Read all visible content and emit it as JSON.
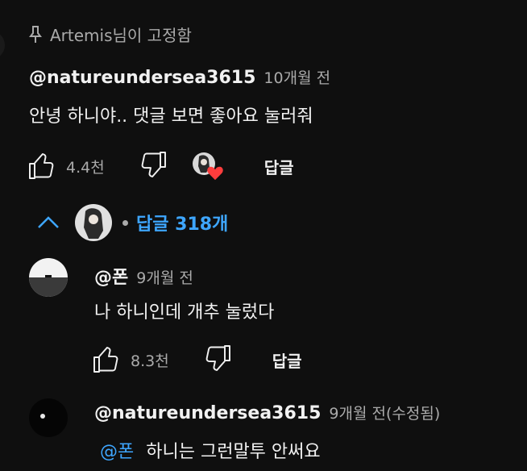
{
  "pinned": {
    "text": "Artemis님이 고정함",
    "icon": "pin-icon"
  },
  "main_comment": {
    "handle": "@natureundersea3615",
    "time": "10개월 전",
    "text": "안녕 하니야.. 댓글 보면 좋아요 눌러줘",
    "likes": "4.4천",
    "reply_label": "답글"
  },
  "replies_toggle": {
    "label": "답글 318개",
    "accent": "#3ea6ff"
  },
  "reply1": {
    "handle": "@폰",
    "time": "9개월 전",
    "text": "나 하니인데 개추 눌렀다",
    "likes": "8.3천",
    "reply_label": "답글"
  },
  "reply2": {
    "handle": "@natureundersea3615",
    "time": "9개월 전(수정됨)",
    "mention": "@폰",
    "text": "하니는 그런말투 안써요"
  }
}
